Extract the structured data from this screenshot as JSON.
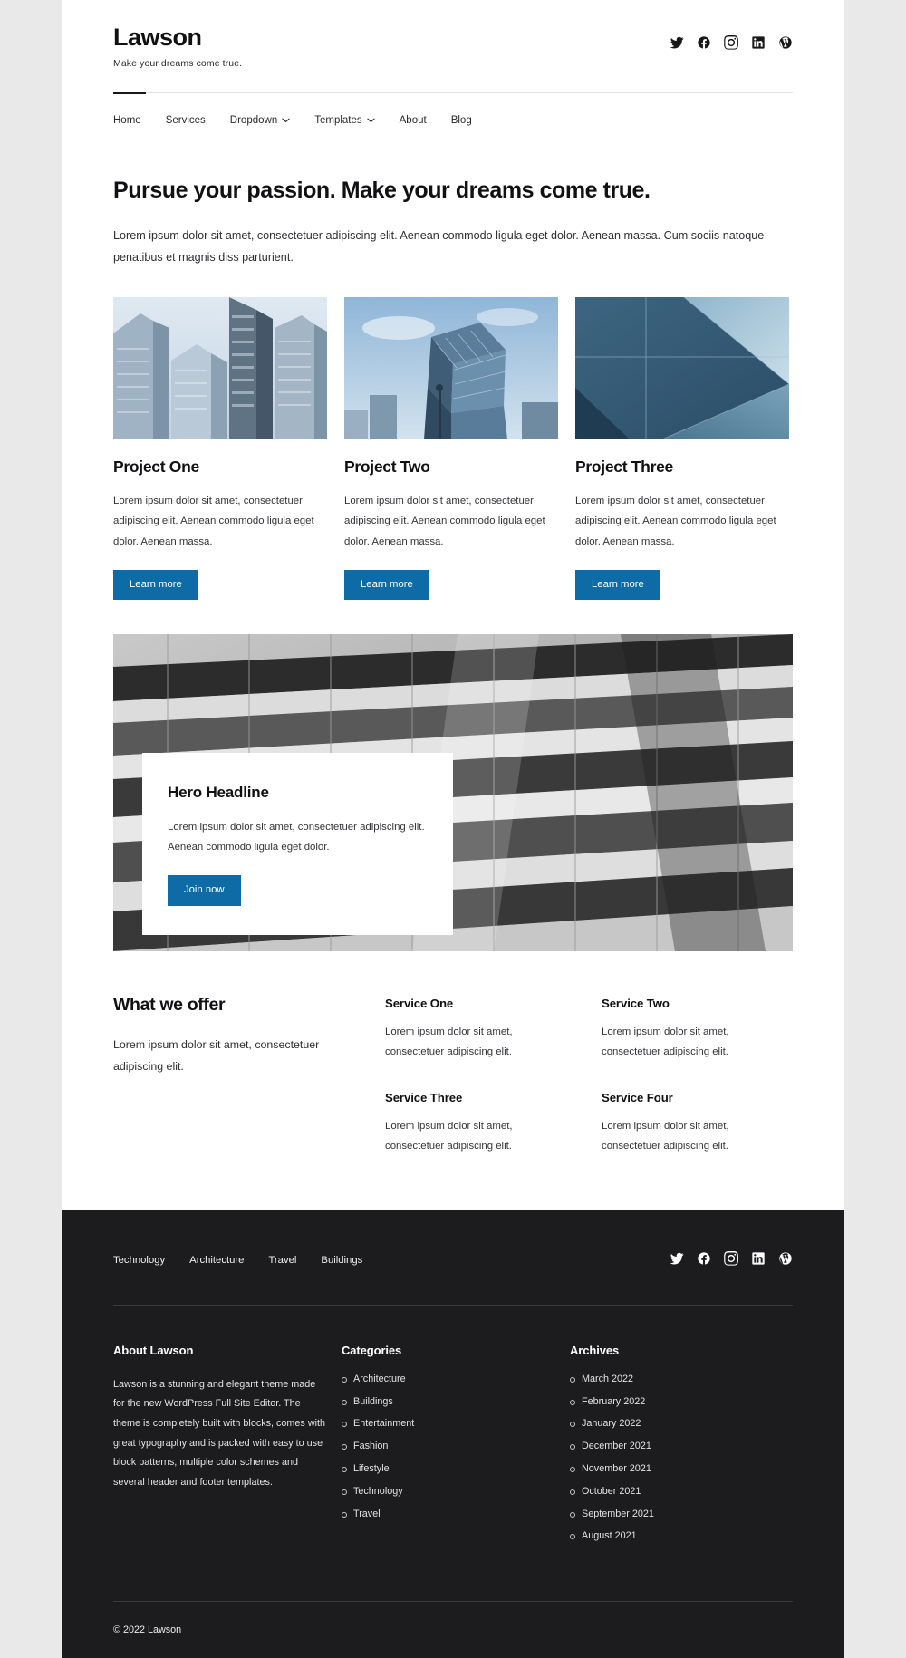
{
  "header": {
    "brand": "Lawson",
    "tagline": "Make your dreams come true.",
    "social": [
      {
        "name": "twitter-icon",
        "label": "Twitter"
      },
      {
        "name": "facebook-icon",
        "label": "Facebook"
      },
      {
        "name": "instagram-icon",
        "label": "Instagram"
      },
      {
        "name": "linkedin-icon",
        "label": "LinkedIn"
      },
      {
        "name": "wordpress-icon",
        "label": "WordPress"
      }
    ]
  },
  "nav": {
    "items": [
      {
        "label": "Home",
        "has_dropdown": false,
        "active": true
      },
      {
        "label": "Services",
        "has_dropdown": false,
        "active": false
      },
      {
        "label": "Dropdown",
        "has_dropdown": true,
        "active": false
      },
      {
        "label": "Templates",
        "has_dropdown": true,
        "active": false
      },
      {
        "label": "About",
        "has_dropdown": false,
        "active": false
      },
      {
        "label": "Blog",
        "has_dropdown": false,
        "active": false
      }
    ]
  },
  "hero": {
    "heading": "Pursue your passion. Make your dreams come true.",
    "subtext": "Lorem ipsum dolor sit amet, consectetuer adipiscing elit. Aenean commodo ligula eget dolor. Aenean massa. Cum sociis natoque penatibus et magnis diss parturient."
  },
  "cards": [
    {
      "title": "Project One",
      "text": "Lorem ipsum dolor sit amet, consectetuer adipiscing elit. Aenean commodo ligula eget dolor. Aenean massa.",
      "button": "Learn more",
      "image_alt": "city-skyscrapers-photo"
    },
    {
      "title": "Project Two",
      "text": "Lorem ipsum dolor sit amet, consectetuer adipiscing elit. Aenean commodo ligula eget dolor. Aenean massa.",
      "button": "Learn more",
      "image_alt": "angular-glass-building-photo"
    },
    {
      "title": "Project Three",
      "text": "Lorem ipsum dolor sit amet, consectetuer adipiscing elit. Aenean commodo ligula eget dolor. Aenean massa.",
      "button": "Learn more",
      "image_alt": "blue-glass-facade-photo"
    }
  ],
  "banner": {
    "image_alt": "grayscale-balconies-architecture-photo",
    "title": "Hero Headline",
    "text": "Lorem ipsum dolor sit amet, consectetuer adipiscing elit. Aenean commodo ligula eget dolor.",
    "button": "Join now"
  },
  "offer": {
    "title": "What we offer",
    "text": "Lorem ipsum dolor sit amet, consectetuer adipiscing elit.",
    "services": [
      {
        "title": "Service One",
        "text": "Lorem ipsum dolor sit amet, consectetuer adipiscing elit."
      },
      {
        "title": "Service Two",
        "text": "Lorem ipsum dolor sit amet, consectetuer adipiscing elit."
      },
      {
        "title": "Service Three",
        "text": "Lorem ipsum dolor sit amet, consectetuer adipiscing elit."
      },
      {
        "title": "Service Four",
        "text": "Lorem ipsum dolor sit amet, consectetuer adipiscing elit."
      }
    ]
  },
  "footer": {
    "nav": [
      "Technology",
      "Architecture",
      "Travel",
      "Buildings"
    ],
    "social": [
      {
        "name": "twitter-icon",
        "label": "Twitter"
      },
      {
        "name": "facebook-icon",
        "label": "Facebook"
      },
      {
        "name": "instagram-icon",
        "label": "Instagram"
      },
      {
        "name": "linkedin-icon",
        "label": "LinkedIn"
      },
      {
        "name": "wordpress-icon",
        "label": "WordPress"
      }
    ],
    "about": {
      "heading": "About Lawson",
      "text": "Lawson is a stunning and elegant theme made for the new WordPress Full Site Editor. The theme is completely built with blocks, comes with great typography and is packed with easy to use block patterns, multiple color schemes and several header and footer templates."
    },
    "categories": {
      "heading": "Categories",
      "items": [
        "Architecture",
        "Buildings",
        "Entertainment",
        "Fashion",
        "Lifestyle",
        "Technology",
        "Travel"
      ]
    },
    "archives": {
      "heading": "Archives",
      "items": [
        "March 2022",
        "February 2022",
        "January 2022",
        "December 2021",
        "November 2021",
        "October 2021",
        "September 2021",
        "August 2021"
      ]
    },
    "copyright": "© 2022 Lawson"
  },
  "colors": {
    "accent_blue": "#0e6ba5",
    "page_bg": "#e9e9e9",
    "footer_bg": "#1c1c1e",
    "text_dark": "#111113"
  }
}
